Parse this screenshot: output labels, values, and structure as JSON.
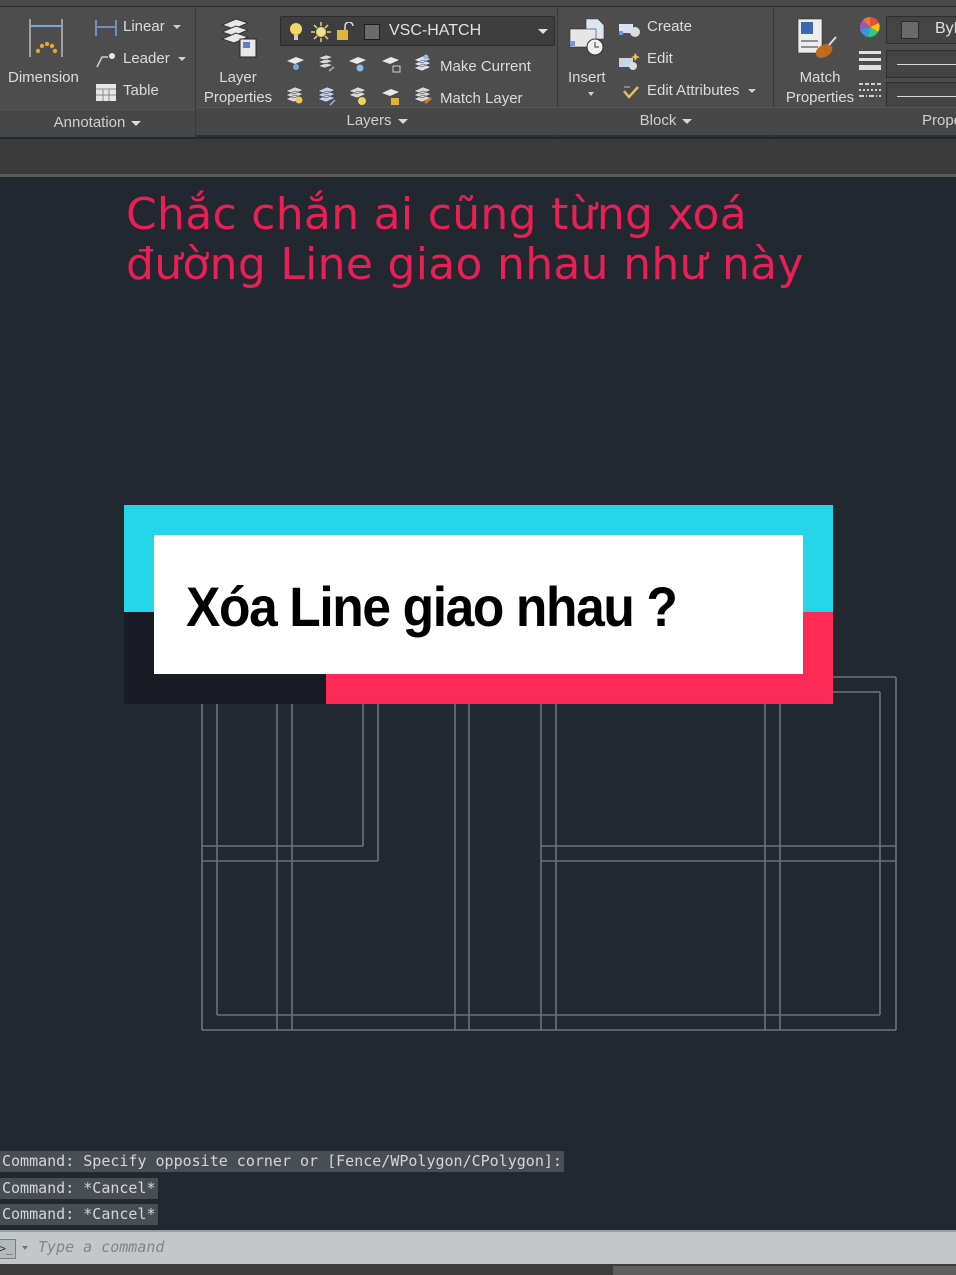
{
  "ribbon": {
    "annotation": {
      "title": "Annotation",
      "dimension_label": "Dimension",
      "linear_label": "Linear",
      "leader_label": "Leader",
      "table_label": "Table"
    },
    "layers": {
      "title": "Layers",
      "layer_properties_label_1": "Layer",
      "layer_properties_label_2": "Properties",
      "current_layer": "VSC-HATCH",
      "make_current_label": "Make Current",
      "match_layer_label": "Match Layer"
    },
    "block": {
      "title": "Block",
      "insert_label": "Insert",
      "create_label": "Create",
      "edit_label": "Edit",
      "edit_attributes_label": "Edit Attributes"
    },
    "properties": {
      "title": "Properties",
      "match_label_1": "Match",
      "match_label_2": "Properties",
      "color_value": "ByL"
    }
  },
  "overlay": {
    "headline_line1": "Chắc chắn ai cũng từng xoá",
    "headline_line2": "đường Line giao nhau như này",
    "banner_text": "Xóa Line giao nhau ?",
    "colors": {
      "headline": "#ea1f55",
      "banner_cyan": "#25d5ea",
      "banner_red": "#fc2a55",
      "banner_dark": "#181b23"
    }
  },
  "command": {
    "history": [
      "Command: Specify opposite corner or [Fence/WPolygon/CPolygon]:",
      "Command: *Cancel*",
      "Command: *Cancel*"
    ],
    "placeholder": "Type a command"
  }
}
